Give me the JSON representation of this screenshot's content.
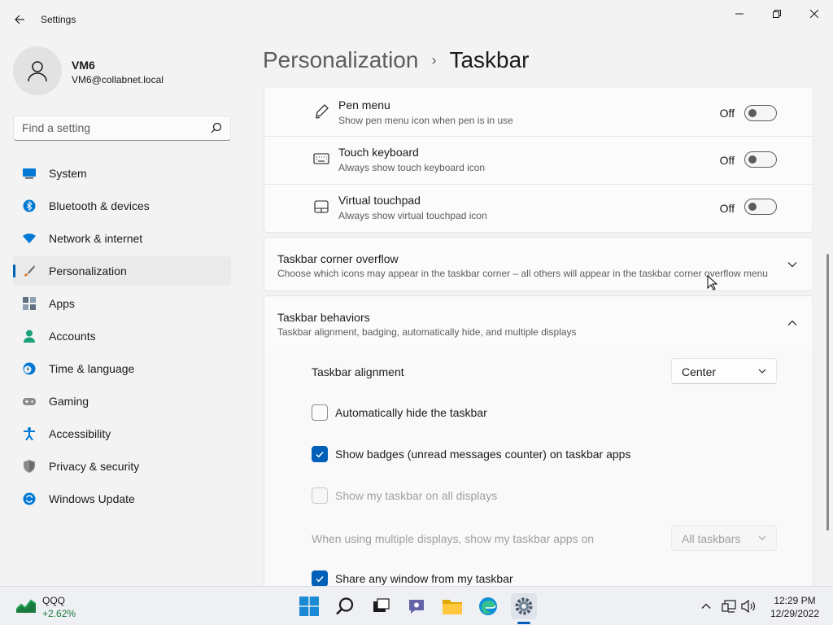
{
  "window": {
    "title": "Settings"
  },
  "user": {
    "name": "VM6",
    "email": "VM6@collabnet.local"
  },
  "search": {
    "placeholder": "Find a setting"
  },
  "sidebar": {
    "items": [
      {
        "label": "System",
        "icon": "system-icon",
        "color": "#0078d4"
      },
      {
        "label": "Bluetooth & devices",
        "icon": "bluetooth-icon",
        "color": "#0078d4"
      },
      {
        "label": "Network & internet",
        "icon": "wifi-icon",
        "color": "#0078d4"
      },
      {
        "label": "Personalization",
        "icon": "brush-icon",
        "color": "#d87a2b",
        "active": true
      },
      {
        "label": "Apps",
        "icon": "apps-icon",
        "color": "#5f6f80"
      },
      {
        "label": "Accounts",
        "icon": "accounts-icon",
        "color": "#1aa37a"
      },
      {
        "label": "Time & language",
        "icon": "clock-globe-icon",
        "color": "#0078d4"
      },
      {
        "label": "Gaming",
        "icon": "gamepad-icon",
        "color": "#6b6b6b"
      },
      {
        "label": "Accessibility",
        "icon": "accessibility-icon",
        "color": "#0078d4"
      },
      {
        "label": "Privacy & security",
        "icon": "shield-icon",
        "color": "#6b6b6b"
      },
      {
        "label": "Windows Update",
        "icon": "update-icon",
        "color": "#0078d4"
      }
    ]
  },
  "breadcrumb": {
    "parent": "Personalization",
    "separator": "›",
    "current": "Taskbar"
  },
  "corner_icons": [
    {
      "title": "Pen menu",
      "subtitle": "Show pen menu icon when pen is in use",
      "state": "Off",
      "icon": "pen-icon"
    },
    {
      "title": "Touch keyboard",
      "subtitle": "Always show touch keyboard icon",
      "state": "Off",
      "icon": "keyboard-icon"
    },
    {
      "title": "Virtual touchpad",
      "subtitle": "Always show virtual touchpad icon",
      "state": "Off",
      "icon": "touchpad-icon"
    }
  ],
  "overflow": {
    "title": "Taskbar corner overflow",
    "subtitle": "Choose which icons may appear in the taskbar corner – all others will appear in the taskbar corner overflow menu"
  },
  "behaviors": {
    "title": "Taskbar behaviors",
    "subtitle": "Taskbar alignment, badging, automatically hide, and multiple displays",
    "alignment_label": "Taskbar alignment",
    "alignment_value": "Center",
    "auto_hide": {
      "label": "Automatically hide the taskbar",
      "checked": false
    },
    "badges": {
      "label": "Show badges (unread messages counter) on taskbar apps",
      "checked": true
    },
    "all_displays": {
      "label": "Show my taskbar on all displays",
      "checked": false,
      "disabled": true
    },
    "multi_display_label": "When using multiple displays, show my taskbar apps on",
    "multi_display_value": "All taskbars",
    "share_window": {
      "label": "Share any window from my taskbar",
      "checked": true
    }
  },
  "taskbar": {
    "stock_name": "QQQ",
    "stock_change": "+2.62%",
    "apps": [
      "start-icon",
      "search-icon",
      "task-view-icon",
      "chat-icon",
      "file-explorer-icon",
      "edge-icon",
      "settings-icon"
    ],
    "time": "12:29 PM",
    "date": "12/29/2022"
  },
  "colors": {
    "accent": "#005fb8",
    "background": "#f3f3f3",
    "card": "#fbfbfb"
  }
}
